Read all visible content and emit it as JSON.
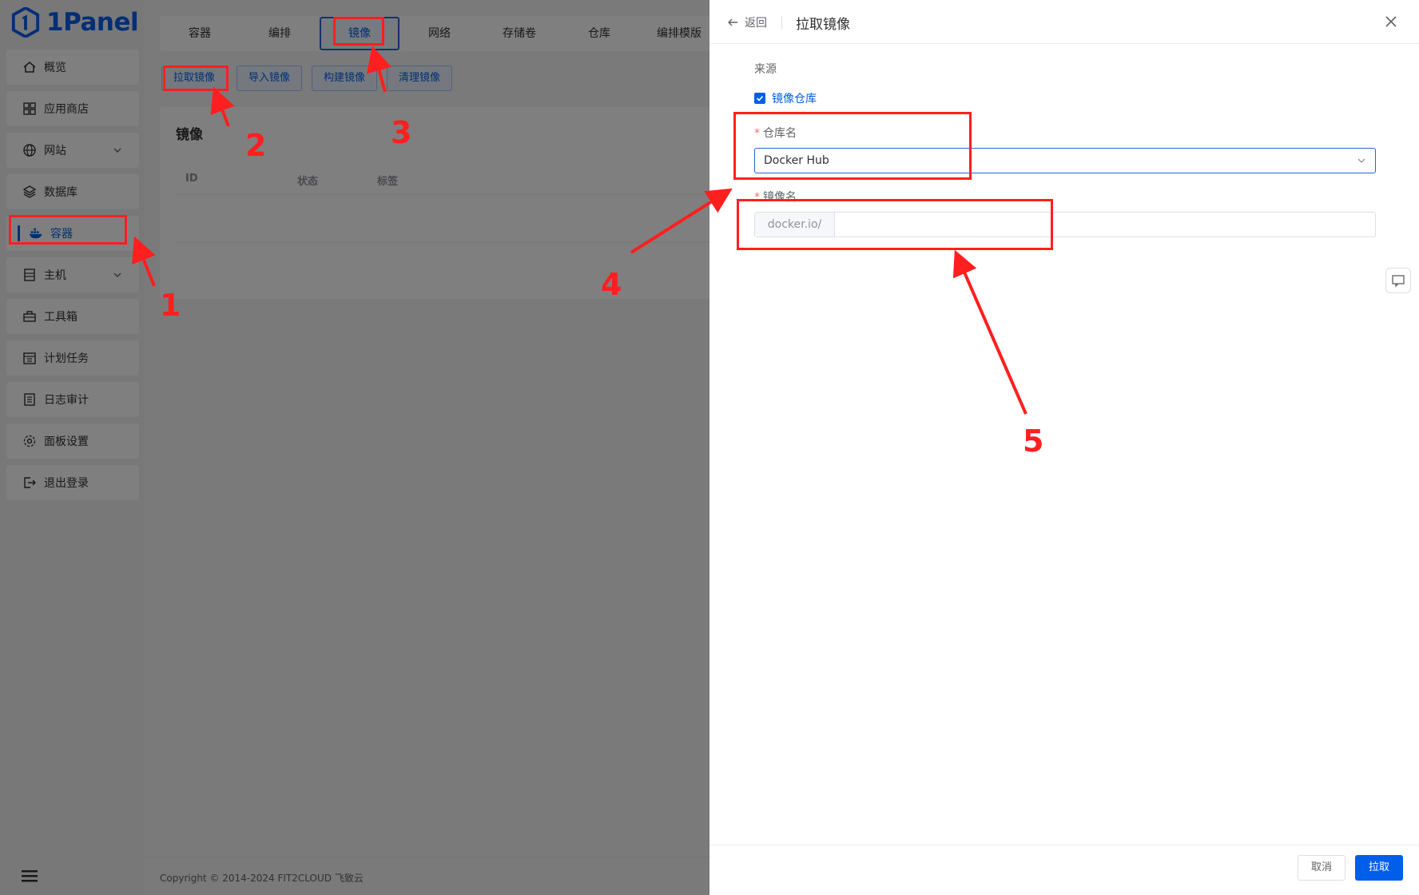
{
  "brand": {
    "name": "1Panel",
    "color": "#005eeb"
  },
  "sidebar": {
    "items": [
      {
        "label": "概览",
        "icon": "home-icon"
      },
      {
        "label": "应用商店",
        "icon": "grid-icon"
      },
      {
        "label": "网站",
        "icon": "globe-icon",
        "expandable": true
      },
      {
        "label": "数据库",
        "icon": "layers-icon"
      },
      {
        "label": "容器",
        "icon": "docker-icon",
        "active": true
      },
      {
        "label": "主机",
        "icon": "server-icon",
        "expandable": true
      },
      {
        "label": "工具箱",
        "icon": "toolbox-icon"
      },
      {
        "label": "计划任务",
        "icon": "calendar-icon"
      },
      {
        "label": "日志审计",
        "icon": "log-icon"
      },
      {
        "label": "面板设置",
        "icon": "gear-icon"
      },
      {
        "label": "退出登录",
        "icon": "logout-icon"
      }
    ]
  },
  "tabs": [
    "容器",
    "编排",
    "镜像",
    "网络",
    "存储卷",
    "仓库",
    "编排模版"
  ],
  "active_tab": "镜像",
  "toolbar": {
    "pull": "拉取镜像",
    "import": "导入镜像",
    "build": "构建镜像",
    "clean": "清理镜像"
  },
  "card": {
    "title": "镜像",
    "columns": [
      "ID",
      "状态",
      "标签"
    ]
  },
  "footer": {
    "copyright": "Copyright © 2014-2024 FIT2CLOUD 飞致云"
  },
  "drawer": {
    "back": "返回",
    "title": "拉取镜像",
    "source_label": "来源",
    "source_option": "镜像仓库",
    "repo_label": "仓库名",
    "repo_value": "Docker Hub",
    "image_label": "镜像名",
    "image_prefix": "docker.io/",
    "image_value": "",
    "cancel": "取消",
    "submit": "拉取"
  },
  "annotations": [
    "1",
    "2",
    "3",
    "4",
    "5"
  ],
  "colors": {
    "primary": "#005eeb",
    "annotation": "#ff1f1f"
  }
}
